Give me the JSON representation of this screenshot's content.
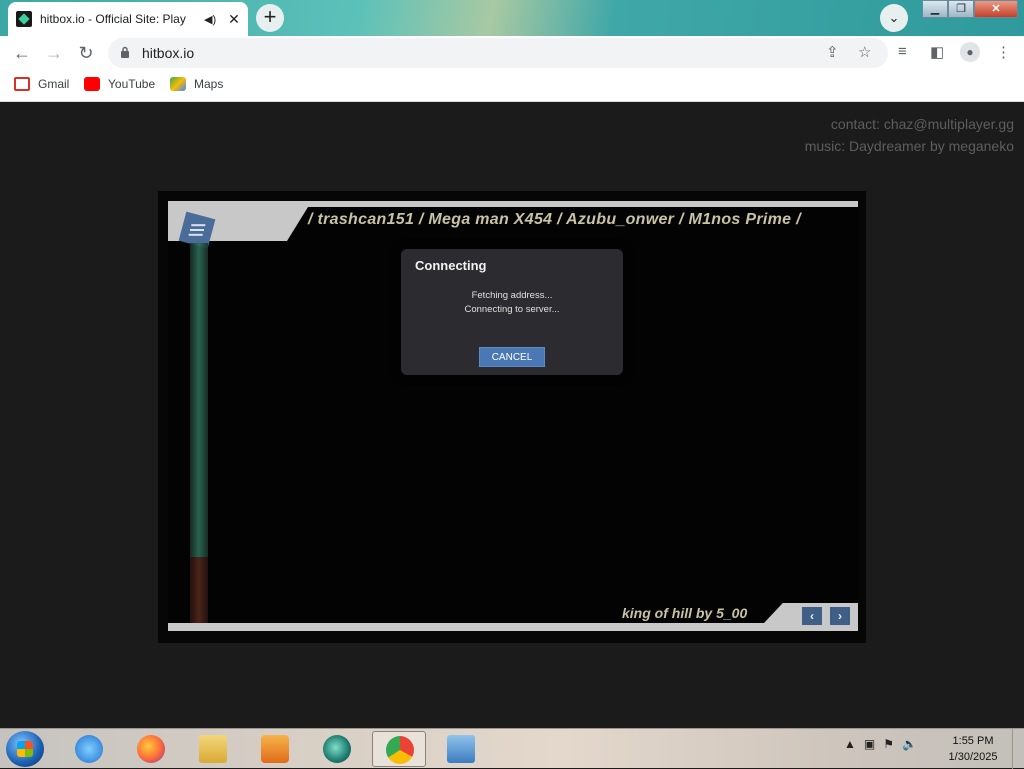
{
  "browser": {
    "tab_title": "hitbox.io - Official Site: Play",
    "audio_icon": "speaker-icon",
    "url": "hitbox.io",
    "bookmarks": [
      {
        "label": "Gmail",
        "icon": "gmail-icon",
        "color": "#d93025"
      },
      {
        "label": "YouTube",
        "icon": "youtube-icon",
        "color": "#ff0000"
      },
      {
        "label": "Maps",
        "icon": "maps-icon",
        "color": "#34a853"
      }
    ]
  },
  "page": {
    "contact": "contact: chaz@multiplayer.gg",
    "music": "music: Daydreamer by meganeko"
  },
  "game": {
    "ticker": "/  trashcan151  /  Mega man X454  /  Azubu_onwer  /  M1nos Prime  /",
    "map_info": "king of hill by 5_00",
    "prev_label": "‹",
    "next_label": "›"
  },
  "dialog": {
    "title": "Connecting",
    "line1": "Fetching address...",
    "line2": "Connecting to server...",
    "cancel_label": "CANCEL"
  },
  "taskbar": {
    "time": "1:55 PM",
    "date": "1/30/2025"
  },
  "colors": {
    "accent_blue": "#4a78b4",
    "ticker_text": "#c9c2a4",
    "health_green": "#2c6f57"
  }
}
